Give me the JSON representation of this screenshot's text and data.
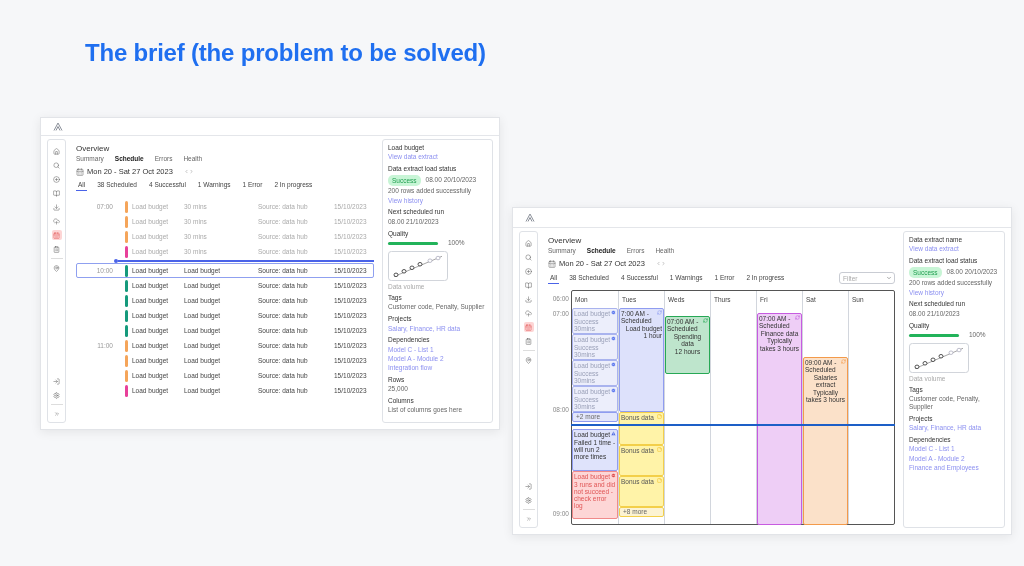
{
  "heading": "The brief (the problem to be solved)",
  "list_window": {
    "sidebar": [
      {
        "selected": false
      },
      {
        "selected": false
      },
      {
        "selected": false
      },
      {
        "selected": false
      },
      {
        "selected": false
      },
      {
        "selected": false
      },
      {
        "selected": true
      },
      {
        "selected": false
      },
      {
        "selected": false
      }
    ],
    "title": "Overview",
    "nav_tabs": [
      {
        "label": "Summary",
        "selected": false
      },
      {
        "label": "Schedule",
        "selected": true
      },
      {
        "label": "Errors",
        "selected": false
      },
      {
        "label": "Health",
        "selected": false
      }
    ],
    "date_range": "Mon 20 - Sat 27 Oct 2023",
    "filters": [
      {
        "label": "All",
        "selected": true
      },
      {
        "label": "38 Scheduled",
        "selected": false
      },
      {
        "label": "4 Successful",
        "selected": false
      },
      {
        "label": "1 Warnings",
        "selected": false
      },
      {
        "label": "1 Error",
        "selected": false
      },
      {
        "label": "2 In progress",
        "selected": false
      }
    ],
    "rows": [
      {
        "time": "07:00",
        "name": "Load budget",
        "detail": "30 mins",
        "source": "Source: data hub",
        "date": "15/10/2023",
        "color": "#f5a55a",
        "dimmed": true,
        "selected": false
      },
      {
        "name": "Load budget",
        "detail": "30 mins",
        "source": "Source: data hub",
        "date": "15/10/2023",
        "color": "#f5a55a",
        "dimmed": true,
        "selected": false
      },
      {
        "name": "Load budget",
        "detail": "30 mins",
        "source": "Source: data hub",
        "date": "15/10/2023",
        "color": "#f5a55a",
        "dimmed": true,
        "selected": false
      },
      {
        "name": "Load budget",
        "detail": "30 mins",
        "source": "Source: data hub",
        "date": "15/10/2023",
        "color": "#e8409a",
        "dimmed": true,
        "selected": false
      },
      {
        "time": "10:00",
        "name": "Load budget",
        "detail": "Load budget",
        "source": "Source: data hub",
        "date": "15/10/2023",
        "color": "#159a7c",
        "dimmed": false,
        "selected": true
      },
      {
        "name": "Load budget",
        "detail": "Load budget",
        "source": "Source: data hub",
        "date": "15/10/2023",
        "color": "#159a7c",
        "dimmed": false,
        "selected": false
      },
      {
        "name": "Load budget",
        "detail": "Load budget",
        "source": "Source: data hub",
        "date": "15/10/2023",
        "color": "#159a7c",
        "dimmed": false,
        "selected": false
      },
      {
        "name": "Load budget",
        "detail": "Load budget",
        "source": "Source: data hub",
        "date": "15/10/2023",
        "color": "#159a7c",
        "dimmed": false,
        "selected": false
      },
      {
        "name": "Load budget",
        "detail": "Load budget",
        "source": "Source: data hub",
        "date": "15/10/2023",
        "color": "#159a7c",
        "dimmed": false,
        "selected": false
      },
      {
        "time": "11:00",
        "name": "Load budget",
        "detail": "Load budget",
        "source": "Source: data hub",
        "date": "15/10/2023",
        "color": "#f5a55a",
        "dimmed": false,
        "selected": false
      },
      {
        "name": "Load budget",
        "detail": "Load budget",
        "source": "Source: data hub",
        "date": "15/10/2023",
        "color": "#f5a55a",
        "dimmed": false,
        "selected": false
      },
      {
        "name": "Load budget",
        "detail": "Load budget",
        "source": "Source: data hub",
        "date": "15/10/2023",
        "color": "#f5a55a",
        "dimmed": false,
        "selected": false
      },
      {
        "name": "Load budget",
        "detail": "Load budget",
        "source": "Source: data hub",
        "date": "15/10/2023",
        "color": "#e8409a",
        "dimmed": false,
        "selected": false
      }
    ],
    "details": {
      "title": "Load budget",
      "link": "View data extract",
      "status": {
        "label": "Data extract load status",
        "badge": "Success",
        "time": "08.00 20/10/2023",
        "note": "200 rows added successfully",
        "link": "View history"
      },
      "next_run": {
        "label": "Next scheduled run",
        "value": "08.00 21/10/2023"
      },
      "quality": {
        "label": "Quality",
        "level": 1,
        "reading": "100%"
      },
      "chart_caption": "Data volume",
      "sections": [
        {
          "heading": "Tags",
          "lines": [
            {
              "text": "Customer code, Penalty, Supplier",
              "kind": "text"
            }
          ]
        },
        {
          "heading": "Projects",
          "lines": [
            {
              "text": "Salary, Finance, HR data",
              "kind": "link"
            }
          ]
        },
        {
          "heading": "Dependencies",
          "lines": [
            {
              "text": "Model C - List 1",
              "kind": "link"
            },
            {
              "text": "Model A - Module 2",
              "kind": "link"
            },
            {
              "text": "Integration flow",
              "kind": "link"
            }
          ]
        },
        {
          "heading": "Rows",
          "lines": [
            {
              "text": "25,000",
              "kind": "text"
            }
          ]
        },
        {
          "heading": "Columns",
          "lines": [
            {
              "text": "List of columns goes here",
              "kind": "text"
            }
          ]
        }
      ]
    }
  },
  "calendar_window": {
    "sidebar": [
      {
        "selected": false
      },
      {
        "selected": false
      },
      {
        "selected": false
      },
      {
        "selected": false
      },
      {
        "selected": false
      },
      {
        "selected": false
      },
      {
        "selected": true
      },
      {
        "selected": false
      },
      {
        "selected": false
      }
    ],
    "title": "Overview",
    "nav_tabs": [
      {
        "label": "Summary",
        "selected": false
      },
      {
        "label": "Schedule",
        "selected": true
      },
      {
        "label": "Errors",
        "selected": false
      },
      {
        "label": "Health",
        "selected": false
      }
    ],
    "date_range": "Mon 20 - Sat 27 Oct 2023",
    "filters": [
      {
        "label": "All",
        "selected": true
      },
      {
        "label": "38 Scheduled",
        "selected": false
      },
      {
        "label": "4 Successful",
        "selected": false
      },
      {
        "label": "1 Warnings",
        "selected": false
      },
      {
        "label": "1 Error",
        "selected": false
      },
      {
        "label": "2 In progress",
        "selected": false
      }
    ],
    "filter_select": {
      "placeholder": "Filter"
    },
    "times": [
      "06:00",
      "07:00",
      "08:00",
      "09:00"
    ],
    "days": [
      {
        "label": "Mon",
        "events": [
          {
            "kind": "success",
            "title": "Load budget",
            "lines": [
              "Success 30mins"
            ]
          },
          {
            "kind": "success",
            "title": "Load budget",
            "lines": [
              "Success 30mins"
            ]
          },
          {
            "kind": "success",
            "title": "Load budget",
            "lines": [
              "Success 30mins"
            ]
          },
          {
            "kind": "success",
            "title": "Load budget",
            "lines": [
              "Success 30mins"
            ]
          },
          {
            "kind": "more",
            "title": "+2 more",
            "color": "#8f9cf0"
          },
          {
            "kind": "warning",
            "title": "Load budget",
            "lines": [
              "Failed 1 time - will run 2 more times"
            ]
          },
          {
            "kind": "error",
            "title": "Load budget",
            "lines": [
              "3 runs and did not succeed - check error log"
            ]
          }
        ]
      },
      {
        "label": "Tues",
        "events": [
          {
            "kind": "scheduled",
            "title": "7:00 AM - Scheduled",
            "lines": [
              "Load budget",
              "1 hour"
            ],
            "color": "#8f9cf0"
          },
          {
            "kind": "pending",
            "title": "Bonus data"
          },
          {
            "kind": "pending",
            "title": "Bonus data"
          },
          {
            "kind": "pending",
            "title": "Bonus data"
          },
          {
            "kind": "more",
            "title": "+8 more",
            "color": "#f3cf4a"
          }
        ]
      },
      {
        "label": "Weds",
        "events": [
          {
            "kind": "scheduled",
            "title": "07:00 AM - Scheduled",
            "lines": [
              "Spending data",
              "12 hours"
            ],
            "color": "#27a855"
          }
        ]
      },
      {
        "label": "Thurs"
      },
      {
        "label": "Fri",
        "events": [
          {
            "kind": "scheduled",
            "title": "07:00 AM - Scheduled",
            "lines": [
              "Finance data",
              "Typically takes 3 hours"
            ],
            "color": "#c75be0"
          }
        ]
      },
      {
        "label": "Sat",
        "events": [
          {
            "kind": "scheduled",
            "title": "09:00 AM - Scheduled",
            "lines": [
              "Salaries extract",
              "Typically takes 3 hours"
            ],
            "color": "#f39a4b"
          }
        ]
      },
      {
        "label": "Sun"
      }
    ],
    "details": {
      "title": "Data extract name",
      "link": "View data extract",
      "status": {
        "label": "Data extract load status",
        "badge": "Success",
        "time": "08.00 20/10/2023",
        "note": "200 rows added successfully",
        "link": "View history"
      },
      "next_run": {
        "label": "Next scheduled run",
        "value": "08.00 21/10/2023"
      },
      "quality": {
        "label": "Quality",
        "level": 1,
        "reading": "100%"
      },
      "chart_caption": "Data volume",
      "sections": [
        {
          "heading": "Tags",
          "lines": [
            {
              "text": "Customer code, Penalty, Supplier",
              "kind": "text"
            }
          ]
        },
        {
          "heading": "Projects",
          "lines": [
            {
              "text": "Salary, Finance, HR data",
              "kind": "link"
            }
          ]
        },
        {
          "heading": "Dependencies",
          "lines": [
            {
              "text": "Model C - List 1",
              "kind": "link"
            },
            {
              "text": "Model A - Module 2",
              "kind": "link"
            },
            {
              "text": "Finance and Employees",
              "kind": "link"
            }
          ]
        }
      ]
    }
  }
}
